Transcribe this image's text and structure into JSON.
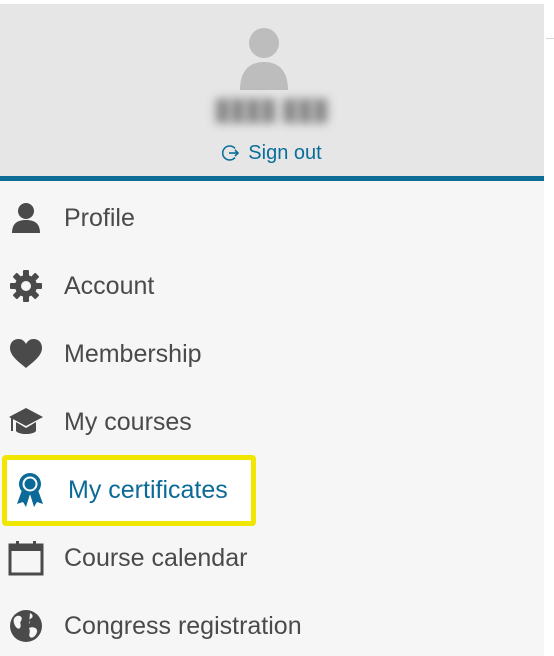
{
  "user": {
    "name": "████ ███",
    "sign_out_label": "Sign out"
  },
  "menu": {
    "items": [
      {
        "label": "Profile",
        "icon": "person-icon"
      },
      {
        "label": "Account",
        "icon": "gear-icon"
      },
      {
        "label": "Membership",
        "icon": "heart-icon"
      },
      {
        "label": "My courses",
        "icon": "graduation-cap-icon"
      },
      {
        "label": "My certificates",
        "icon": "award-ribbon-icon",
        "active": true
      },
      {
        "label": "Course calendar",
        "icon": "calendar-icon"
      },
      {
        "label": "Congress registration",
        "icon": "globe-icon"
      }
    ]
  },
  "colors": {
    "accent": "#0b6a97",
    "highlight": "#f0e600",
    "icon": "#4a4a4a",
    "header_bg": "#e6e6e6"
  }
}
